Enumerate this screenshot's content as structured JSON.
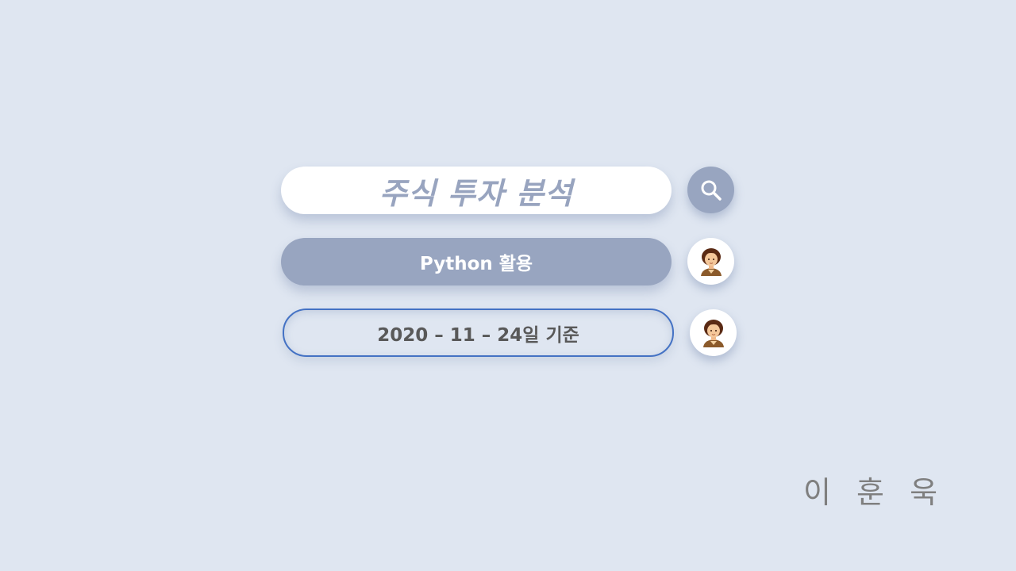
{
  "search": {
    "title": "주식 투자 분석",
    "icon": "search-icon"
  },
  "subtitle": {
    "label": "Python 활용",
    "avatar_icon": "person-avatar-icon"
  },
  "date": {
    "label": "2020 – 11 – 24일 기준",
    "avatar_icon": "person-avatar-icon"
  },
  "author": {
    "name": "이 훈 욱"
  },
  "colors": {
    "background": "#dfe6f1",
    "accent": "#98a5c0",
    "outline": "#4472c4",
    "title_text": "#98a4bf",
    "date_text": "#595959",
    "author_text": "#7f7f7f"
  }
}
